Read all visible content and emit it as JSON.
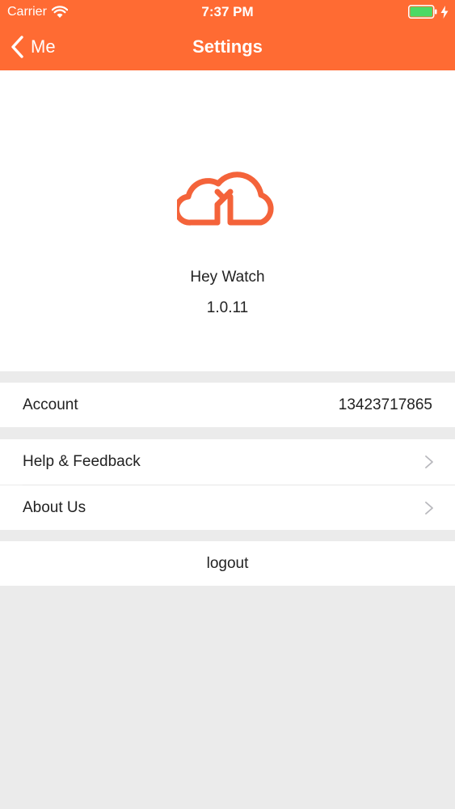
{
  "status_bar": {
    "carrier": "Carrier",
    "time": "7:37 PM",
    "battery_color": "#4cd964"
  },
  "nav": {
    "back_label": "Me",
    "title": "Settings",
    "bar_color": "#ff6b33"
  },
  "app_info": {
    "logo_icon": "cloud-y-logo-icon",
    "name": "Hey Watch",
    "version": "1.0.11",
    "logo_color": "#f4633a"
  },
  "account": {
    "label": "Account",
    "value": "13423717865"
  },
  "menu": {
    "items": [
      {
        "label": "Help & Feedback",
        "icon": "chevron-right-icon"
      },
      {
        "label": "About Us",
        "icon": "chevron-right-icon"
      }
    ]
  },
  "logout": {
    "label": "logout"
  }
}
